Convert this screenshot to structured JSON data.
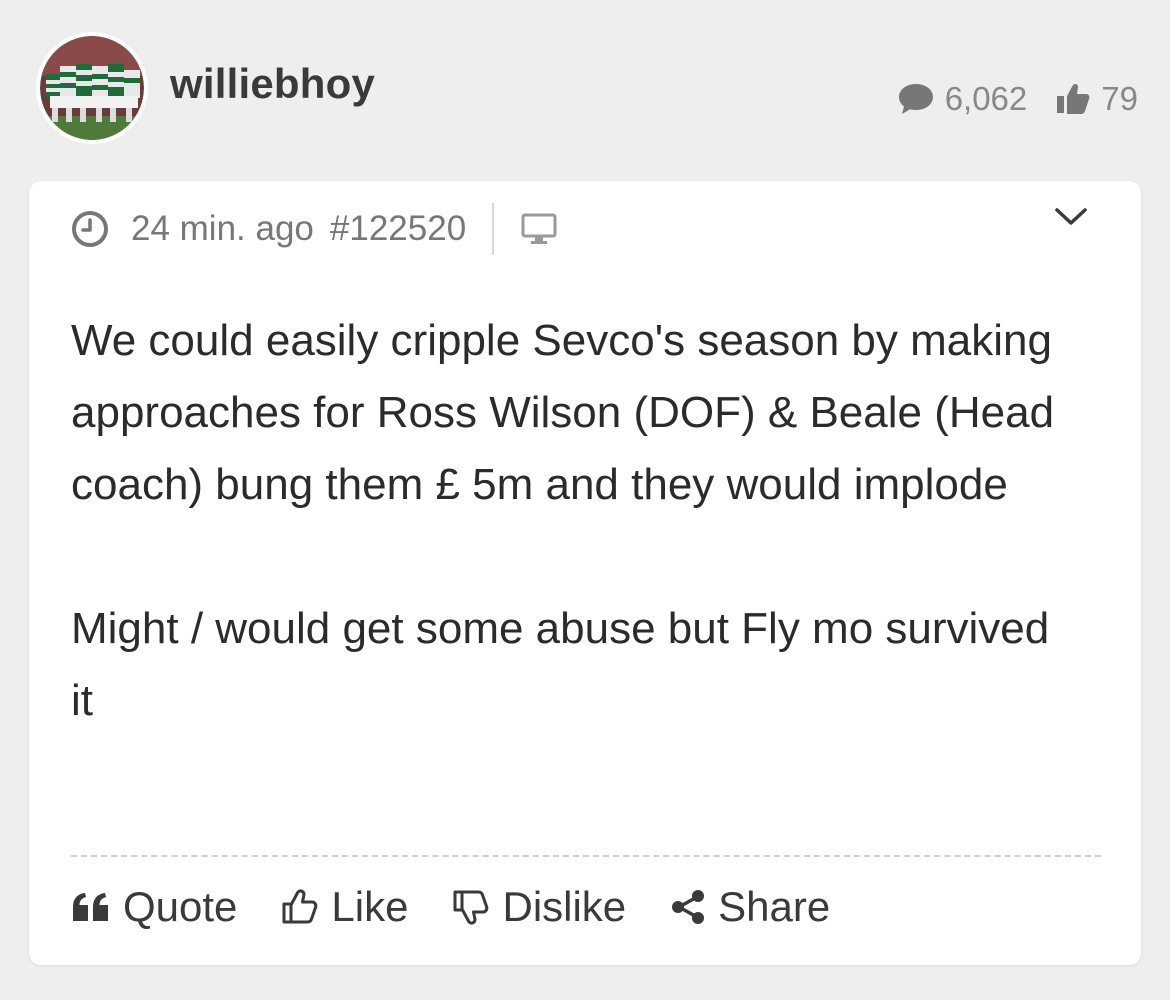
{
  "user": {
    "avatar_icon": "team-huddle-avatar",
    "name": "williebhoy",
    "posts_icon": "speech-bubble-icon",
    "posts_count": "6,062",
    "likes_icon": "thumbs-up-icon",
    "likes_count": "79"
  },
  "post": {
    "time": "24 min. ago",
    "number": "#122520",
    "device_icon": "desktop-icon",
    "menu_icon": "chevron-down-icon",
    "paragraphs": [
      "We could easily cripple Sevco's season by making approaches for Ross Wilson (DOF) & Beale (Head coach) bung them £ 5m and they would implode",
      "Might / would get some abuse but Fly mo survived it"
    ]
  },
  "actions": {
    "quote_label": "Quote",
    "like_label": "Like",
    "dislike_label": "Dislike",
    "share_label": "Share"
  },
  "colors": {
    "page_background": "#eeeeee",
    "card_background": "#ffffff",
    "muted_text": "#888888",
    "body_text": "#2b2b2b"
  }
}
